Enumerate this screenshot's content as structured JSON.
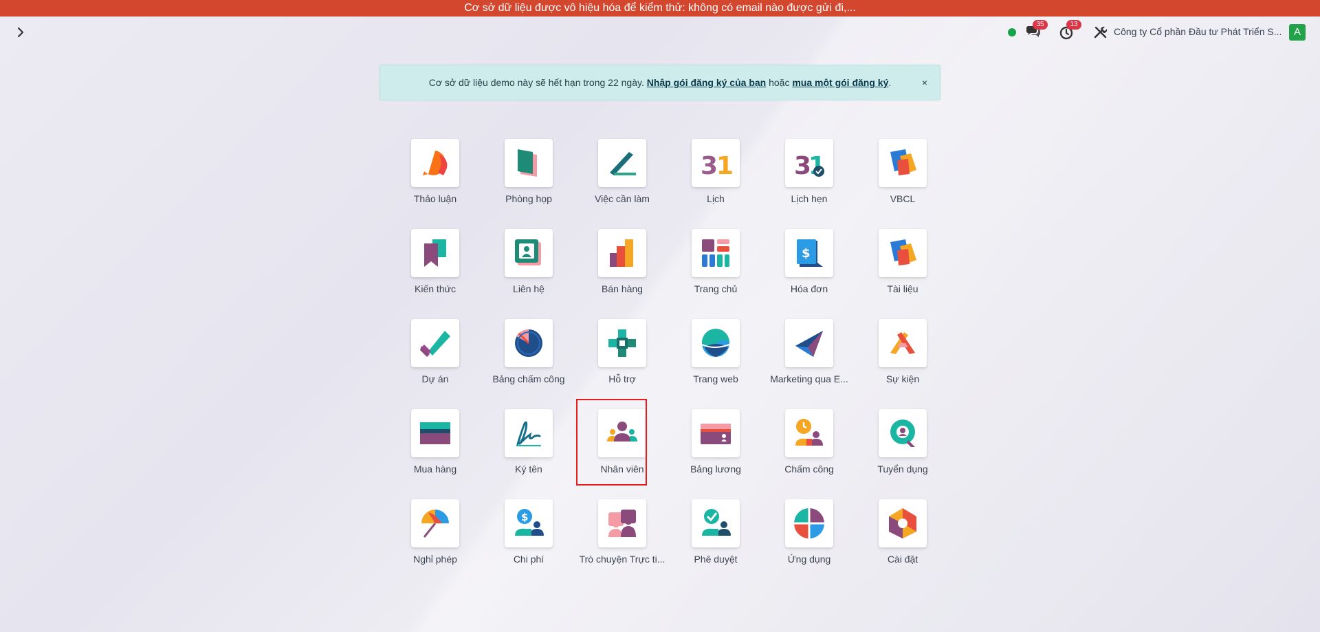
{
  "warning_banner": "Cơ sở dữ liệu được vô hiệu hóa để kiểm thử: không có email nào được gửi đi,...",
  "systray": {
    "chat_count": "35",
    "activity_count": "13",
    "company_name": "Công ty Cổ phần Đầu tư Phát Triển S...",
    "user_initial": "A",
    "status_color": "#16a34a"
  },
  "demo_alert": {
    "text_before": "Cơ sở dữ liệu demo này sẽ hết hạn trong 22 ngày.",
    "link_register": "Nhập gói đăng ký của bạn",
    "text_middle": "hoặc",
    "link_buy": "mua một gói đăng ký",
    "text_end": ".",
    "close": "×"
  },
  "apps": [
    {
      "label": "Thảo luận",
      "icon": "discuss-icon"
    },
    {
      "label": "Phòng họp",
      "icon": "meeting-room-icon"
    },
    {
      "label": "Việc cần làm",
      "icon": "todo-icon"
    },
    {
      "label": "Lịch",
      "icon": "calendar-icon"
    },
    {
      "label": "Lịch hẹn",
      "icon": "appointment-icon"
    },
    {
      "label": "VBCL",
      "icon": "vbcl-icon"
    },
    {
      "label": "Kiến thức",
      "icon": "knowledge-icon"
    },
    {
      "label": "Liên hệ",
      "icon": "contacts-icon"
    },
    {
      "label": "Bán hàng",
      "icon": "sales-icon"
    },
    {
      "label": "Trang chủ",
      "icon": "dashboard-icon"
    },
    {
      "label": "Hóa đơn",
      "icon": "invoicing-icon"
    },
    {
      "label": "Tài liệu",
      "icon": "documents-icon"
    },
    {
      "label": "Dự án",
      "icon": "project-icon"
    },
    {
      "label": "Bảng chấm công",
      "icon": "timesheet-icon"
    },
    {
      "label": "Hỗ trợ",
      "icon": "helpdesk-icon"
    },
    {
      "label": "Trang web",
      "icon": "website-icon"
    },
    {
      "label": "Marketing qua E...",
      "icon": "email-marketing-icon"
    },
    {
      "label": "Sự kiện",
      "icon": "events-icon"
    },
    {
      "label": "Mua hàng",
      "icon": "purchase-icon"
    },
    {
      "label": "Ký tên",
      "icon": "sign-icon"
    },
    {
      "label": "Nhân viên",
      "icon": "employees-icon"
    },
    {
      "label": "Bảng lương",
      "icon": "payroll-icon"
    },
    {
      "label": "Chấm công",
      "icon": "attendance-icon"
    },
    {
      "label": "Tuyển dụng",
      "icon": "recruitment-icon"
    },
    {
      "label": "Nghỉ phép",
      "icon": "time-off-icon"
    },
    {
      "label": "Chi phí",
      "icon": "expenses-icon"
    },
    {
      "label": "Trò chuyện Trực ti...",
      "icon": "live-chat-icon"
    },
    {
      "label": "Phê duyệt",
      "icon": "approvals-icon"
    },
    {
      "label": "Ứng dụng",
      "icon": "apps-icon"
    },
    {
      "label": "Cài đặt",
      "icon": "settings-icon"
    }
  ]
}
